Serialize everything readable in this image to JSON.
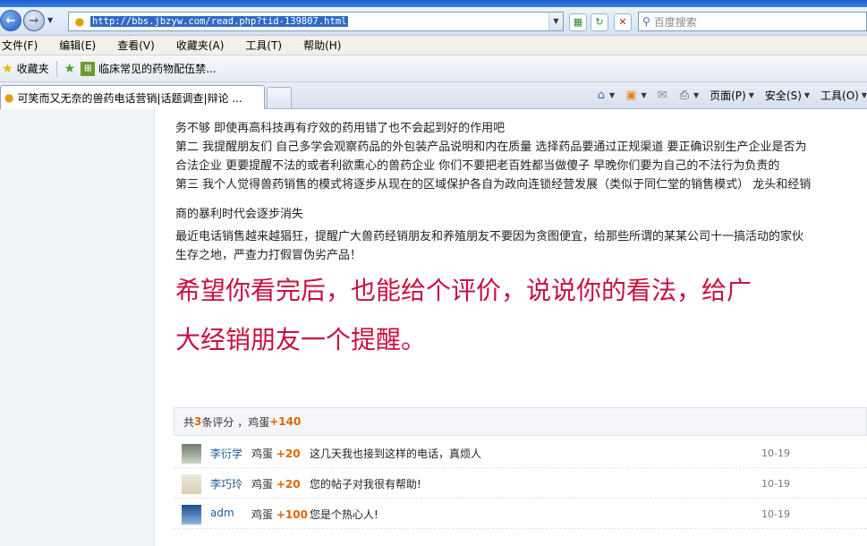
{
  "browser": {
    "url": "http://bbs.jbzyw.com/read.php?tid-139807.html",
    "search_placeholder": "百度搜索",
    "menu": [
      "文件(F)",
      "编辑(E)",
      "查看(V)",
      "收藏夹(A)",
      "工具(T)",
      "帮助(H)"
    ],
    "favorites_label": "收藏夹",
    "favorite_link": "临床常见的药物配伍禁...",
    "tab_title": "可笑而又无奈的兽药电话营销|话题调查|辩论 ...",
    "commands": [
      "页面(P)",
      "安全(S)",
      "工具(O)"
    ]
  },
  "post": {
    "line_cut": "务不够 即使再高科技再有疗效的药用错了也不会起到好的作用吧",
    "line2": "第二 我提醒朋友们 自己多学会观察药品的外包装产品说明和内在质量 选择药品要通过正规渠道 要正确识别生产企业是否为",
    "line3": "合法企业 更要提醒不法的或者利欲熏心的兽药企业 你们不要把老百姓都当做傻子 早晚你们要为自己的不法行为负责的",
    "line4": "第三 我个人觉得兽药销售的模式将逐步从现在的区域保护各自为政向连锁经营发展（类似于同仁堂的销售模式） 龙头和经销",
    "line5": "商的暴利时代会逐步消失",
    "line6": "最近电话销售越来越猖狂，提醒广大兽药经销朋友和养殖朋友不要因为贪图便宜，给那些所谓的某某公司十一搞活动的家伙",
    "line7": "生存之地，严查力打假冒伪劣产品！",
    "big1": " 希望你看完后，也能给个评价，说说你的看法，给广",
    "big2": "大经销朋友一个提醒。"
  },
  "ratings": {
    "summary_prefix": "共",
    "count": "3",
    "summary_mid": "条评分 ，鸡蛋",
    "total": "+140",
    "rows": [
      {
        "user": "李衍学",
        "item": "鸡蛋",
        "points": "+20",
        "reason": "这几天我也接到这样的电话，真烦人",
        "date": "10-19"
      },
      {
        "user": "李巧玲",
        "item": "鸡蛋",
        "points": "+20",
        "reason": "您的帖子对我很有帮助!",
        "date": "10-19"
      },
      {
        "user": "adm",
        "item": "鸡蛋",
        "points": "+100",
        "reason": "您是个热心人!",
        "date": "10-19"
      }
    ]
  }
}
